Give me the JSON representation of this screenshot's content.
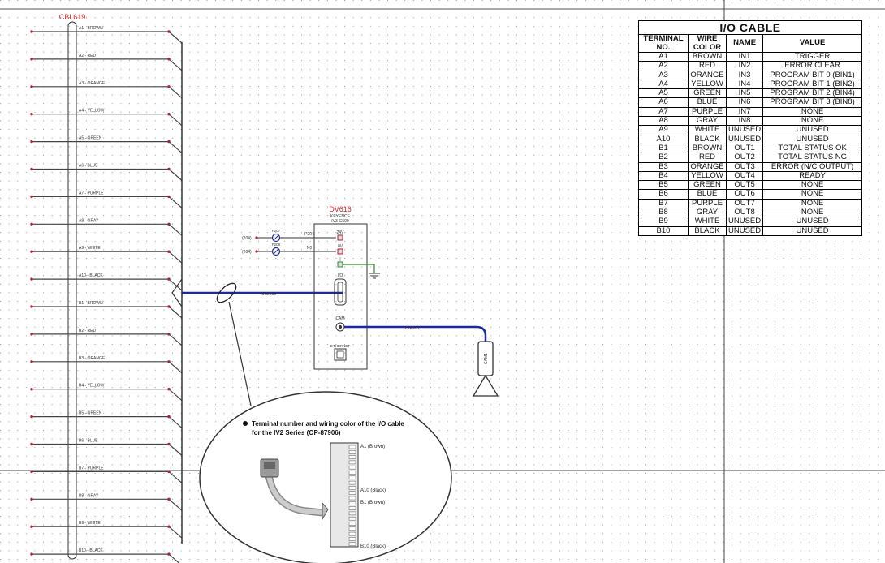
{
  "cable_label": "CBL619",
  "wires": [
    {
      "label": "A1 - BROWN"
    },
    {
      "label": "A2 - RED"
    },
    {
      "label": "A3 - ORANGE"
    },
    {
      "label": "A4 - YELLOW"
    },
    {
      "label": "A5 - GREEN"
    },
    {
      "label": "A6 - BLUE"
    },
    {
      "label": "A7 - PURPLE"
    },
    {
      "label": "A8 - GRAY"
    },
    {
      "label": "A9 - WHITE"
    },
    {
      "label": "A10 - BLACK"
    },
    {
      "label": "B1 - BROWN"
    },
    {
      "label": "B2 - RED"
    },
    {
      "label": "B3 - ORANGE"
    },
    {
      "label": "B4 - YELLOW"
    },
    {
      "label": "B5 - GREEN"
    },
    {
      "label": "B6 - BLUE"
    },
    {
      "label": "B7 - PURPLE"
    },
    {
      "label": "B8 - GRAY"
    },
    {
      "label": "B9 - WHITE"
    },
    {
      "label": "B10 - BLACK"
    }
  ],
  "device": {
    "name": "DV616",
    "maker": "KEYENCE",
    "model": "IV3-G500",
    "port_24v": "24V",
    "port_0v": "0V",
    "port_io": "I/O",
    "port_cam": "CAM",
    "port_eth": "ETHERNET",
    "inputs": [
      {
        "ref": "(204)",
        "fuse": "F207",
        "wire": "P204"
      },
      {
        "ref": "(204)",
        "fuse": "F208",
        "wire": "N0"
      }
    ],
    "io_cable": "CBL619",
    "cam_cable": "CBL601",
    "camera": "CAM1"
  },
  "callout": {
    "title_line1": "Terminal number and wiring color of the I/O cable",
    "title_line2": "for the IV2 Series (OP-87906)",
    "pins": [
      "A1 (Brown)",
      "A10 (Black)",
      "B1 (Brown)",
      "B10 (Black)"
    ]
  },
  "io_table": {
    "title": "I/O CABLE",
    "headers": [
      "TERMINAL NO.",
      "WIRE COLOR",
      "NAME",
      "VALUE"
    ],
    "rows": [
      [
        "A1",
        "BROWN",
        "IN1",
        "TRIGGER"
      ],
      [
        "A2",
        "RED",
        "IN2",
        "ERROR CLEAR"
      ],
      [
        "A3",
        "ORANGE",
        "IN3",
        "PROGRAM BIT 0 (BIN1)"
      ],
      [
        "A4",
        "YELLOW",
        "IN4",
        "PROGRAM BIT 1 (BIN2)"
      ],
      [
        "A5",
        "GREEN",
        "IN5",
        "PROGRAM BIT 2 (BIN4)"
      ],
      [
        "A6",
        "BLUE",
        "IN6",
        "PROGRAM BIT 3 (BIN8)"
      ],
      [
        "A7",
        "PURPLE",
        "IN7",
        "NONE"
      ],
      [
        "A8",
        "GRAY",
        "IN8",
        "NONE"
      ],
      [
        "A9",
        "WHITE",
        "UNUSED",
        "UNUSED"
      ],
      [
        "A10",
        "BLACK",
        "UNUSED",
        "UNUSED"
      ],
      [
        "B1",
        "BROWN",
        "OUT1",
        "TOTAL STATUS OK"
      ],
      [
        "B2",
        "RED",
        "OUT2",
        "TOTAL STATUS NG"
      ],
      [
        "B3",
        "ORANGE",
        "OUT3",
        "ERROR (N/C OUTPUT)"
      ],
      [
        "B4",
        "YELLOW",
        "OUT4",
        "READY"
      ],
      [
        "B5",
        "GREEN",
        "OUT5",
        "NONE"
      ],
      [
        "B6",
        "BLUE",
        "OUT6",
        "NONE"
      ],
      [
        "B7",
        "PURPLE",
        "OUT7",
        "NONE"
      ],
      [
        "B8",
        "GRAY",
        "OUT8",
        "NONE"
      ],
      [
        "B9",
        "WHITE",
        "UNUSED",
        "UNUSED"
      ],
      [
        "B10",
        "BLACK",
        "UNUSED",
        "UNUSED"
      ]
    ]
  },
  "colors": {
    "wire": "#444444",
    "terminal": "#b02030",
    "label_red": "#e02020",
    "cable_blue": "#1a2a9a",
    "ground_green": "#2a8a2a",
    "grid_dot": "#9a9a9a"
  }
}
